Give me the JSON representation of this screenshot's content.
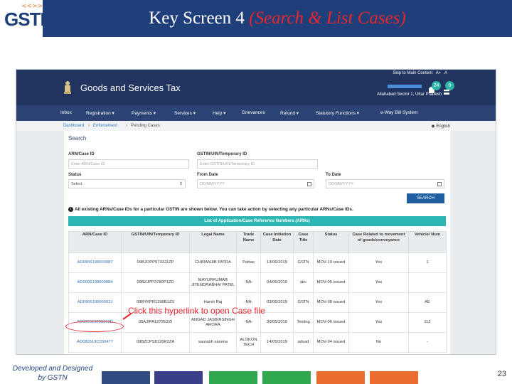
{
  "slide": {
    "logo_text": "GSTN",
    "logo_arrows": "<<>>",
    "title_main": "Key Screen 4 ",
    "title_sub": "(Search & List Cases)",
    "footer_left_line1": "Developed and Designed",
    "footer_left_line2": "by GSTN",
    "page_number": "23",
    "footer_bar_colors": [
      "#2f4b80",
      "#3a3d8a",
      "#2fa84f",
      "#2fa84f",
      "#e86d2e",
      "#e86d2e"
    ]
  },
  "portal": {
    "skip_text": "Skip to Main Content",
    "font_a_plus": "A+",
    "font_a": "A",
    "name": "Goods and Services Tax",
    "location": "Allahabad Sector 1, Uttar Pradesh",
    "badge_1": "24",
    "badge_2": "0",
    "nav": [
      "Inbox",
      "Registration ▾",
      "Payments ▾",
      "Services ▾",
      "Help ▾",
      "Grievances",
      "Refund ▾",
      "Statutory Functions ▾",
      "e-Way Bill System"
    ],
    "breadcrumb": [
      "Dashboard",
      "Enforcement",
      "Pending Cases"
    ],
    "language": "English"
  },
  "search": {
    "heading": "Search",
    "arn_label": "ARN/Case ID",
    "arn_placeholder": "Enter ARN/Case ID",
    "gstin_label": "GSTIN/UIN/Temporary ID",
    "gstin_placeholder": "Enter GSTIN/UIN/Temporary ID",
    "status_label": "Status",
    "status_value": "Select",
    "from_label": "From Date",
    "from_placeholder": "DD/MM/YYYY",
    "to_label": "To Date",
    "to_placeholder": "DD/MM/YYYY",
    "button": "SEARCH",
    "info": "All existing ARNs/Case IDs for a particular GSTIN are shown below. You can take action by selecting any particular ARNs/Case IDs."
  },
  "list": {
    "banner": "List of Application/Case Reference Numbers (ARNs)",
    "headers": [
      "ARN/Case ID",
      "GSTIN/UIN/Temporary ID",
      "Legal Name",
      "Trade Name",
      "Case Initiation Date",
      "Case Title",
      "Status",
      "Case Related to movement of goods/conveyance",
      "Vehicle/ Num"
    ],
    "rows": [
      [
        "AD0906190000087",
        "09BJOPP9733J1ZP",
        "CHIRANJIB PATRA",
        "Patras",
        "13/06/2019",
        "GSTN",
        "MOV-10 issued",
        "Yes",
        "1"
      ],
      [
        "AD0906190000084",
        "09BZJPP3780P1ZD",
        "MAYURKUMAR JITENDRABHAI PATEL",
        "-NA-",
        "04/06/2019",
        "abc",
        "MOV-05 issued",
        "Yes",
        ""
      ],
      [
        "AD090619000002J",
        "09BYKPR1198B1ZS",
        "Harsh Raj",
        "-NA-",
        "03/06/2019",
        "GSTN",
        "MOV-08 issued",
        "Yes",
        "AE"
      ],
      [
        "AD090519000063D",
        "05AJIPA1572E2ZI",
        "ANGAD JASBIRSINGH ARORA",
        "-NA-",
        "30/05/2019",
        "Testing",
        "MOV-06 issued",
        "Yes",
        "112"
      ],
      [
        "AD080519C030477",
        "09BZCPS8126R2ZA",
        "saurabh saxena",
        "ALOKON TECH",
        "14/05/2019",
        "adsad",
        "MOV-04 issued",
        "No",
        "-"
      ]
    ]
  },
  "annotation": {
    "text": "Click this hyperlink to open Case file"
  }
}
